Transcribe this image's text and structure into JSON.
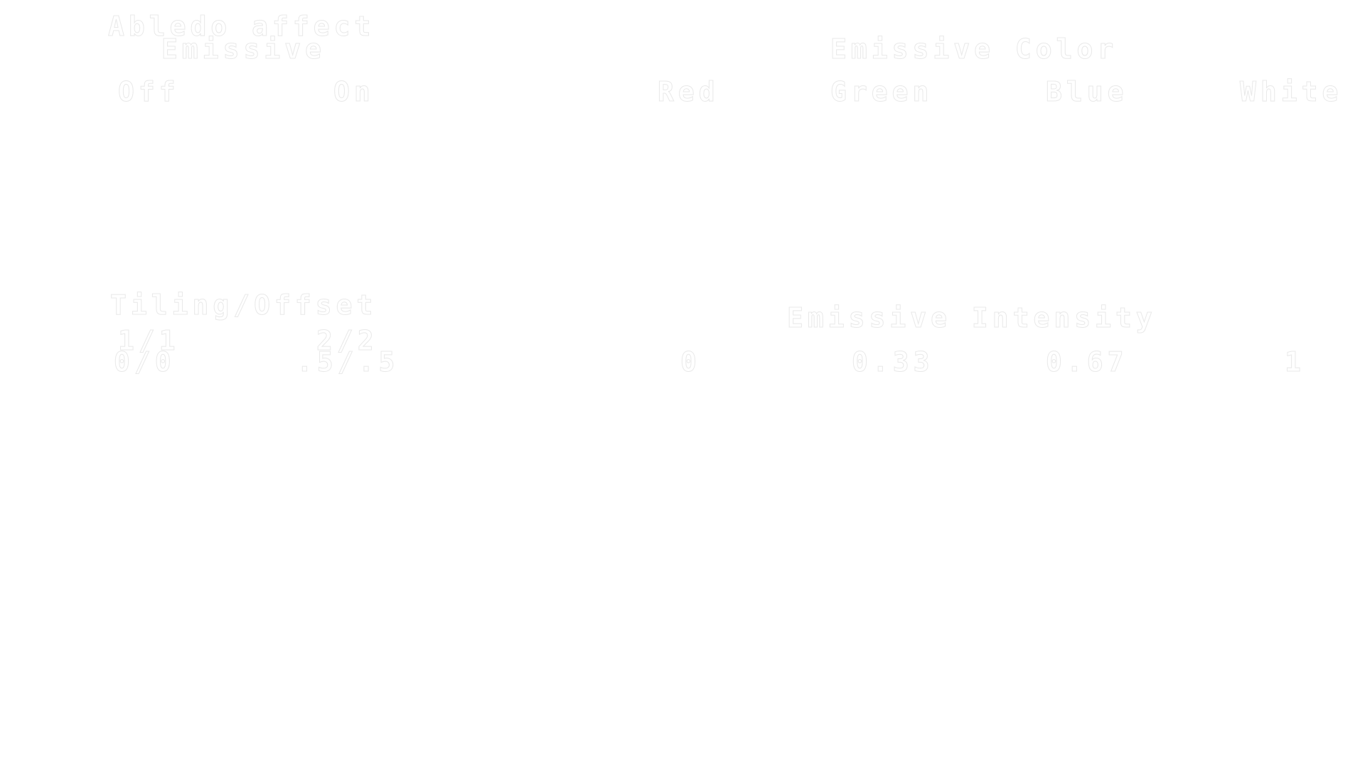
{
  "albedo": {
    "title": "Abledo affect",
    "subtitle": "Emissive",
    "options": [
      "Off",
      "On"
    ]
  },
  "emissive_color": {
    "title": "Emissive Color",
    "options": [
      "Red",
      "Green",
      "Blue",
      "White"
    ]
  },
  "tiling": {
    "title": "Tiling/Offset",
    "tiling_values": [
      "1/1",
      "2/2"
    ],
    "offset_values": [
      "0/0",
      ".5/.5"
    ]
  },
  "emissive_intensity": {
    "title": "Emissive Intensity",
    "options": [
      "0",
      "0.33",
      "0.67",
      "1"
    ]
  },
  "colors": {
    "background": "#ffffff",
    "text_fill": "#ffffff",
    "text_outline": "#e9e9e9"
  }
}
